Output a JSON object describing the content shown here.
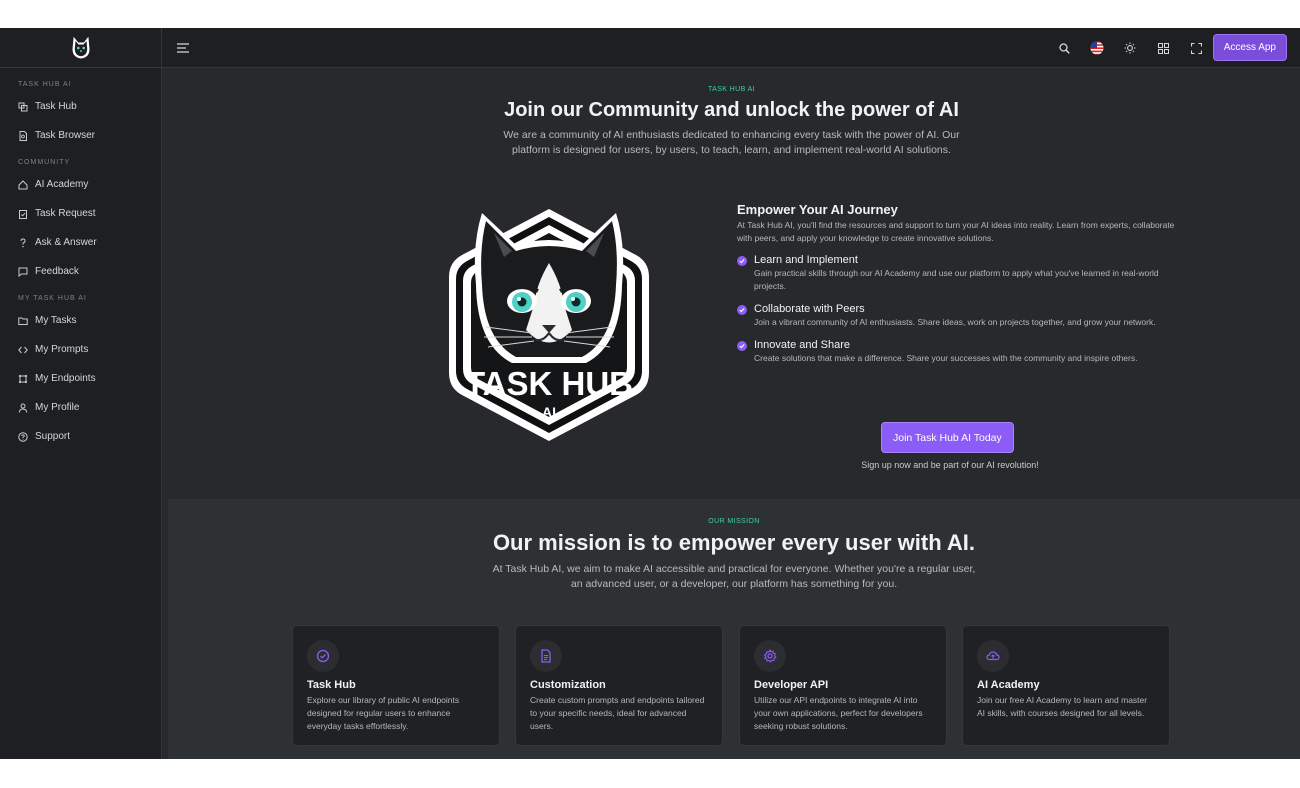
{
  "sidebar": {
    "sections": [
      {
        "title": "TASK HUB AI",
        "items": [
          {
            "label": "Task Hub",
            "icon": "task-hub-icon"
          },
          {
            "label": "Task Browser",
            "icon": "task-browser-icon"
          }
        ]
      },
      {
        "title": "COMMUNITY",
        "items": [
          {
            "label": "AI Academy",
            "icon": "home-icon"
          },
          {
            "label": "Task Request",
            "icon": "clipboard-icon"
          },
          {
            "label": "Ask & Answer",
            "icon": "question-icon"
          },
          {
            "label": "Feedback",
            "icon": "chat-icon"
          }
        ]
      },
      {
        "title": "MY TASK HUB AI",
        "items": [
          {
            "label": "My Tasks",
            "icon": "folder-icon"
          },
          {
            "label": "My Prompts",
            "icon": "code-icon"
          },
          {
            "label": "My Endpoints",
            "icon": "endpoints-icon"
          },
          {
            "label": "My Profile",
            "icon": "user-icon"
          },
          {
            "label": "Support",
            "icon": "help-circle-icon"
          }
        ]
      }
    ]
  },
  "topbar": {
    "access_label": "Access App"
  },
  "hero": {
    "eyebrow": "TASK HUB AI",
    "title": "Join our Community and unlock the power of AI",
    "subtitle_line1": "We are a community of AI enthusiasts dedicated to enhancing every task with the power of AI. Our",
    "subtitle_line2": "platform is designed for users, by users, to teach, learn, and implement real-world AI solutions."
  },
  "logo": {
    "text_main": "TASK HUB",
    "text_sub": "AI"
  },
  "journey": {
    "title": "Empower Your AI Journey",
    "lead": "At Task Hub AI, you'll find the resources and support to turn your AI ideas into reality. Learn from experts, collaborate with peers, and apply your knowledge to create innovative solutions.",
    "features": [
      {
        "title": "Learn and Implement",
        "text": "Gain practical skills through our AI Academy and use our platform to apply what you've learned in real-world projects."
      },
      {
        "title": "Collaborate with Peers",
        "text": "Join a vibrant community of AI enthusiasts. Share ideas, work on projects together, and grow your network."
      },
      {
        "title": "Innovate and Share",
        "text": "Create solutions that make a difference. Share your successes with the community and inspire others."
      }
    ],
    "cta_label": "Join Task Hub AI Today",
    "cta_note": "Sign up now and be part of our AI revolution!"
  },
  "mission": {
    "eyebrow": "OUR MISSION",
    "title": "Our mission is to empower every user with AI.",
    "subtitle_line1": "At Task Hub AI, we aim to make AI accessible and practical for everyone. Whether you're a regular user,",
    "subtitle_line2": "an advanced user, or a developer, our platform has something for you.",
    "cards": [
      {
        "title": "Task Hub",
        "text": "Explore our library of public AI endpoints designed for regular users to enhance everyday tasks effortlessly.",
        "icon": "check-badge-icon"
      },
      {
        "title": "Customization",
        "text": "Create custom prompts and endpoints tailored to your specific needs, ideal for advanced users.",
        "icon": "document-icon"
      },
      {
        "title": "Developer API",
        "text": "Utilize our API endpoints to integrate AI into your own applications, perfect for developers seeking robust solutions.",
        "icon": "gear-icon"
      },
      {
        "title": "AI Academy",
        "text": "Join our free AI Academy to learn and master AI skills, with courses designed for all levels.",
        "icon": "cloud-upload-icon"
      }
    ]
  },
  "colors": {
    "accent": "#8b5cf6",
    "eyebrow": "#3ecf9e",
    "background": "#27292c",
    "sidebar": "#1d1f22"
  }
}
